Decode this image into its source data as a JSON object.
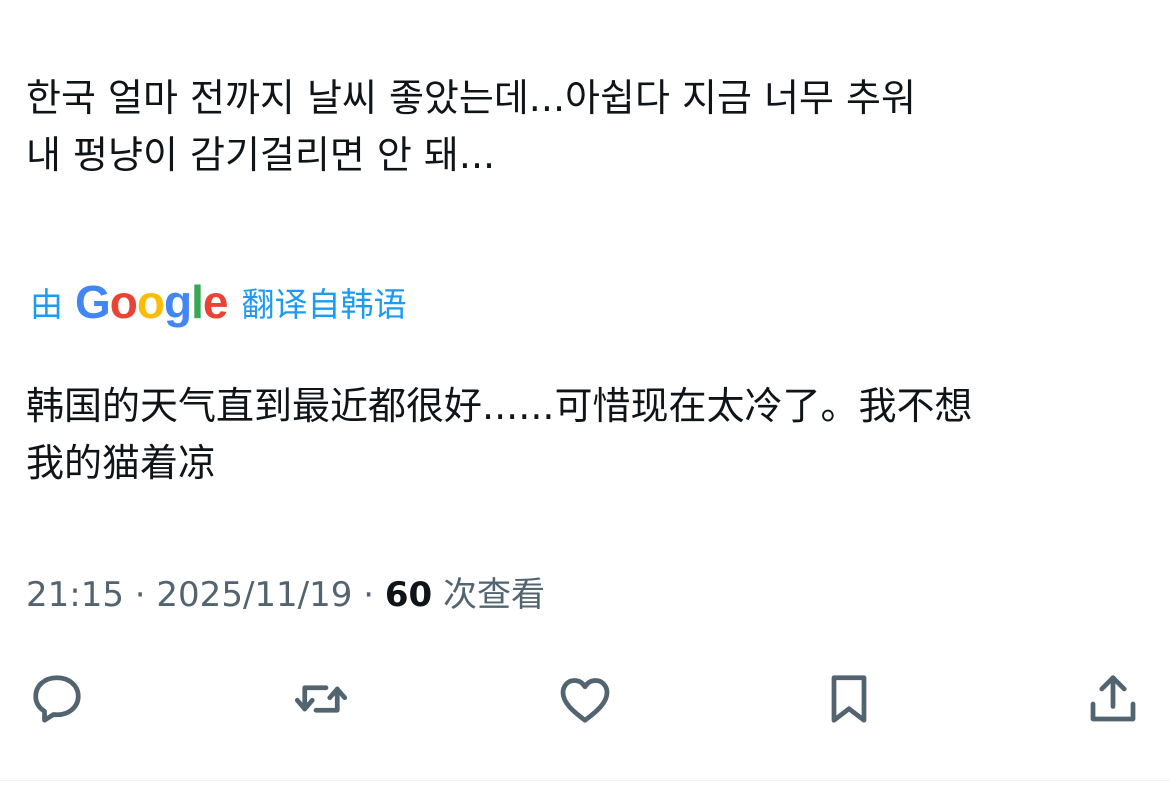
{
  "tweet": {
    "original_lines": [
      "한국 얼마 전까지 날씨 좋았는데...아쉽다 지금 너무 추워",
      "내 펑냥이 감기걸리면 안 돼..."
    ],
    "translation_prefix": "由",
    "translation_provider": "Google",
    "translation_suffix": "翻译自韩语",
    "translated_lines": [
      "韩国的天气直到最近都很好......可惜现在太冷了。我不想",
      "我的猫着凉"
    ]
  },
  "meta": {
    "time": "21:15",
    "separator": "·",
    "date": "2025/11/19",
    "views_count": "60",
    "views_label": "次查看"
  },
  "actions": [
    {
      "icon": "reply-icon"
    },
    {
      "icon": "retweet-icon"
    },
    {
      "icon": "like-icon"
    },
    {
      "icon": "bookmark-icon"
    },
    {
      "icon": "share-icon"
    }
  ],
  "colors": {
    "text": "#0f1419",
    "secondary": "#536471",
    "link": "#1d9bf0",
    "google_blue": "#4285f4",
    "google_red": "#ea4335",
    "google_yellow": "#fbbc05",
    "google_green": "#34a853"
  }
}
